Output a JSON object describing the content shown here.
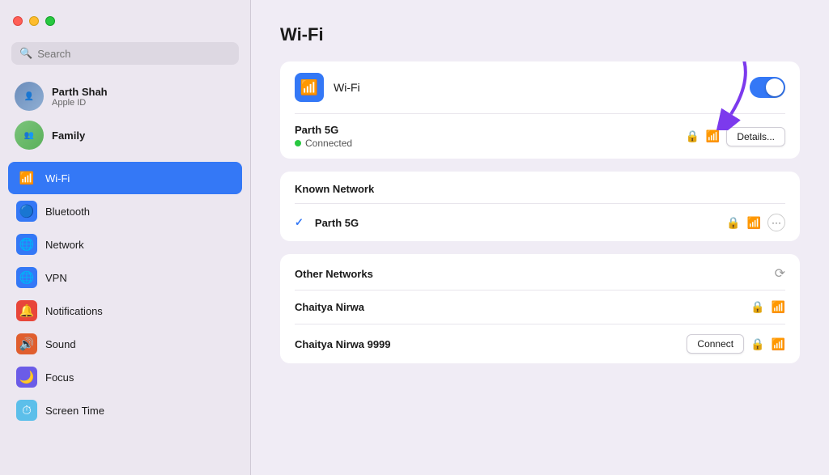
{
  "titlebar": {
    "buttons": [
      "close",
      "minimize",
      "maximize"
    ]
  },
  "sidebar": {
    "search": {
      "placeholder": "Search"
    },
    "user": {
      "name": "Parth Shah",
      "subtitle": "Apple ID"
    },
    "family": {
      "label": "Family"
    },
    "nav_items": [
      {
        "id": "wifi",
        "label": "Wi-Fi",
        "icon": "📶",
        "active": true
      },
      {
        "id": "bluetooth",
        "label": "Bluetooth",
        "icon": "🔵"
      },
      {
        "id": "network",
        "label": "Network",
        "icon": "🌐"
      },
      {
        "id": "vpn",
        "label": "VPN",
        "icon": "🌐"
      },
      {
        "id": "notifications",
        "label": "Notifications",
        "icon": "🔔"
      },
      {
        "id": "sound",
        "label": "Sound",
        "icon": "🔊"
      },
      {
        "id": "focus",
        "label": "Focus",
        "icon": "🌙"
      },
      {
        "id": "screentime",
        "label": "Screen Time",
        "icon": "⏱"
      }
    ]
  },
  "main": {
    "title": "Wi-Fi",
    "wifi_toggle_label": "Wi-Fi",
    "toggle_on": true,
    "connected_network": {
      "name": "Parth 5G",
      "status": "Connected",
      "details_label": "Details..."
    },
    "known_network_section": "Known Network",
    "known_networks": [
      {
        "name": "Parth 5G",
        "checked": true
      }
    ],
    "other_networks_section": "Other Networks",
    "other_networks": [
      {
        "name": "Chaitya Nirwa",
        "connect": false
      },
      {
        "name": "Chaitya Nirwa 9999",
        "connect": true,
        "connect_label": "Connect"
      }
    ]
  }
}
